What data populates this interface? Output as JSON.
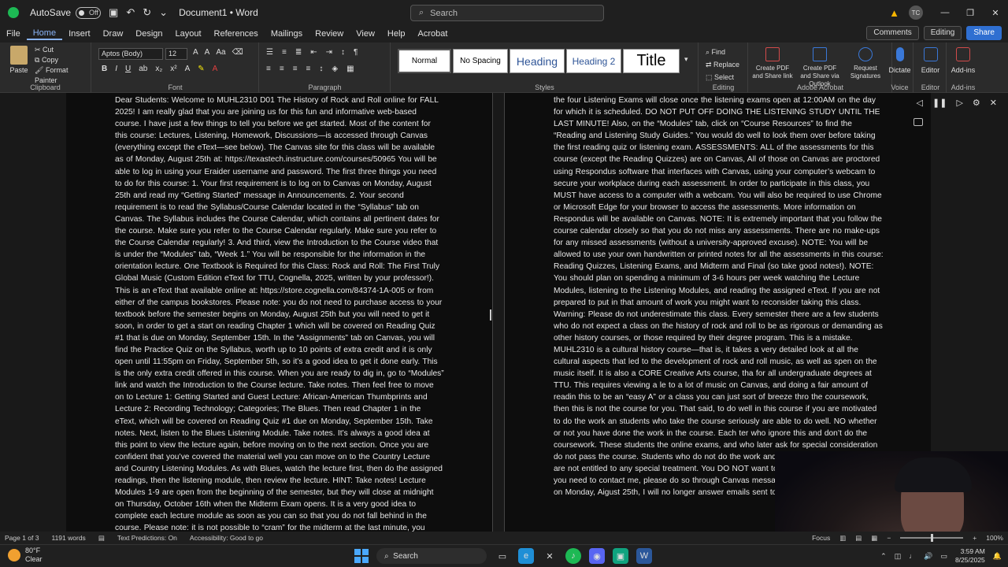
{
  "titlebar": {
    "autosave_label": "AutoSave",
    "autosave_state": "Off",
    "doc_title": "Document1 • Word",
    "search_placeholder": "Search",
    "avatar_initials": "TC"
  },
  "ribbon_tabs": [
    "File",
    "Home",
    "Insert",
    "Draw",
    "Design",
    "Layout",
    "References",
    "Mailings",
    "Review",
    "View",
    "Help",
    "Acrobat"
  ],
  "ribbon_right": {
    "comments": "Comments",
    "editing": "Editing",
    "share": "Share"
  },
  "ribbon": {
    "clipboard": {
      "paste": "Paste",
      "cut": "Cut",
      "copy": "Copy",
      "format_painter": "Format Painter",
      "label": "Clipboard"
    },
    "font": {
      "family": "Aptos (Body)",
      "size": "12",
      "label": "Font"
    },
    "paragraph": {
      "label": "Paragraph"
    },
    "styles": {
      "items": [
        "Normal",
        "No Spacing",
        "Heading",
        "Heading 2",
        "Title"
      ],
      "label": "Styles"
    },
    "editing": {
      "find": "Find",
      "replace": "Replace",
      "select": "Select",
      "label": "Editing"
    },
    "acrobat": {
      "items": [
        "Create PDF and Share link",
        "Create PDF and Share via Outlook",
        "Request Signatures"
      ],
      "label": "Adobe Acrobat"
    },
    "voice": {
      "item": "Dictate",
      "label": "Voice"
    },
    "editor": {
      "item": "Editor",
      "label": "Editor"
    },
    "addins": {
      "item": "Add-ins",
      "label": "Add-ins"
    }
  },
  "document": {
    "page1": "Dear Students: Welcome to MUHL2310 D01 The History of Rock and Roll online for FALL 2025! I am really glad that you are joining us for this fun and informative web-based course. I have just a few things to tell you before we get started. Most of the content for this course: Lectures, Listening, Homework, Discussions—is accessed through Canvas (everything except the eText—see below). The Canvas site for this class will be available as of Monday, August 25th at: https://texastech.instructure.com/courses/50965 You will be able to log in using your Eraider username and password. The first three things you need to do for this course: 1. Your first requirement is to log on to Canvas on Monday, August 25th and read my “Getting Started” message in Announcements. 2. Your second requirement is to read the Syllabus/Course Calendar located in the “Syllabus” tab on Canvas. The Syllabus includes the Course Calendar, which contains all pertinent dates for the course. Make sure you refer to the Course Calendar regularly. Make sure you refer to the Course Calendar regularly! 3. And third, view the Introduction to the Course video that is under the “Modules” tab, “Week 1.” You will be responsible for the information in the orientation lecture. One Textbook is Required for this Class: Rock and Roll: The First Truly Global Music (Custom Edition eText for TTU, Cognella, 2025, written by your professor!). This is an eText that available online at: https://store.cognella.com/84374-1A-005 or from either of the campus bookstores. Please note: you do not need to purchase access to your textbook before the semester begins on Monday, August 25th but you will need to get it soon, in order to get a start on reading Chapter 1 which will be covered on Reading Quiz #1 that is due on Monday, September 15th. In the “Assignments” tab on Canvas, you will find the Practice Quiz on the Syllabus, worth up to 10 points of extra credit and it is only open until 11:55pm on Friday, September 5th, so it’s a good idea to get it done early. This is the only extra credit offered in this course. When you are ready to dig in, go to “Modules” link and watch the Introduction to the Course lecture. Take notes. Then feel free to move on to Lecture 1: Getting Started and Guest Lecture: African-American Thumbprints and Lecture 2: Recording Technology; Categories; The Blues. Then read Chapter 1 in the eText, which will be covered on Reading Quiz #1 due on Monday, September 15th. Take notes. Next, listen to the Blues Listening Module. Take notes. It’s always a good idea at this point to view the lecture again, before moving on to the next section. Once you are confident that you’ve covered the material well you can move on to the Country Lecture and Country Listening Modules. As with Blues, watch the lecture first, then do the assigned readings, then the listening module, then review the lecture. HINT: Take notes! Lecture Modules 1-9 are open from the beginning of the semester, but they will close at midnight on Thursday, October 16th when the Midterm Exam opens. It is a very good idea to complete each lecture module as soon as you can so that you do not fall behind in the course. Please note: it is not possible to “cram” for the midterm at the last minute, you must work consistently from the",
    "page2": "the four Listening Exams will close once the listening exams open at 12:00AM on the day for which it is scheduled. DO NOT PUT OFF DOING THE LISTENING STUDY UNTIL THE LAST MINUTE! Also, on the “Modules” tab, click on “Course Resources” to find the “Reading and Listening Study Guides.” You would do well to look them over before taking the first reading quiz or listening exam. ASSESSMENTS: ALL of the assessments for this course (except the Reading Quizzes) are on Canvas, All of those on Canvas are proctored using Respondus software that interfaces with Canvas, using your computer’s webcam to secure your workplace during each assessment. In order to participate in this class, you MUST have access to a computer with a webcam. You will also be required to use Chrome or Microsoft Edge for your browser to access the assessments. More information on Respondus will be available on Canvas. NOTE: It is extremely important that you follow the course calendar closely so that you do not miss any assessments. There are no make-ups for any missed assessments (without a university-approved excuse). NOTE: You will be allowed to use your own handwritten or printed notes for all the assessments in this course: Reading Quizzes, Listening Exams, and Midterm and Final (so take good notes!). NOTE: You should plan on spending a minimum of 3-6 hours per week watching the Lecture Modules, listening to the Listening Modules, and reading the assigned eText. If you are not prepared to put in that amount of work you might want to reconsider taking this class. Warning: Please do not underestimate this class. Every semester there are a few students who do not expect a class on the history of rock and roll to be as rigorous or demanding as other history courses, or those required by their degree program. This is a mistake. MUHL2310 is a cultural history course—that is, it takes a very detailed look at all the cultural aspects that led to the development of rock and roll music, as well as spen on the music itself. It is also a CORE Creative Arts course, tha for all undergraduate degrees at TTU. This requires viewing a le to a lot of music on Canvas, and doing a fair amount of readin this to be an “easy A” or a class you can just sort of breeze thro the coursework, then this is not the course for you. That said, to do well in this course if you are motivated to do the work an students who take the course seriously are able to do well. NO whether or not you have done the work in the course. Each ter who ignore this and don’t do the coursework. These students the online exams, and who later ask for special consideration do not pass the course. Students who do not do the work and/or “forget” the assessments are not entitled to any special treatment. You DO NOT want to be one of these people. If you need to contact me, please do so through Canvas messages. Once the course starts on Monday, Aigust 25th, I will no longer answer emails sent to my TTU address –I WILL"
  },
  "statusbar": {
    "page": "Page 1 of 3",
    "words": "1191 words",
    "text_predictions": "Text Predictions: On",
    "accessibility": "Accessibility: Good to go",
    "focus": "Focus",
    "zoom": "100%"
  },
  "taskbar": {
    "temp": "80°F",
    "condition": "Clear",
    "search": "Search",
    "time": "3:59 AM",
    "date": "8/25/2025"
  },
  "colors": {
    "accent": "#8ab4f8",
    "share": "#2f6fd1",
    "warning": "#f7b500"
  }
}
